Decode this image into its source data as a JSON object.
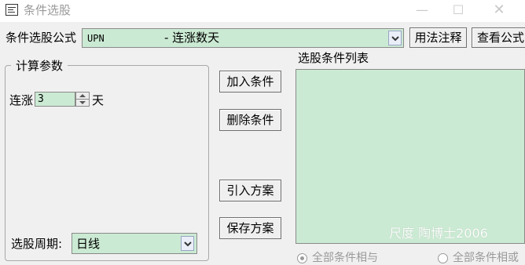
{
  "window": {
    "title": "条件选股",
    "controls": {
      "minimize": "—",
      "maximize": "☐",
      "close": "✕"
    }
  },
  "formula": {
    "label": "条件选股公式",
    "selected_code": "UPN",
    "selected_name": "- 连涨数天",
    "usage_note_button": "用法注释",
    "view_formula_button": "查看公式"
  },
  "params": {
    "group_title": "计算参数",
    "lianzhang_label": "连涨",
    "lianzhang_value": "3",
    "lianzhang_unit": "天",
    "period_label": "选股周期:",
    "period_value": "日线"
  },
  "actions": {
    "add_condition": "加入条件",
    "delete_condition": "删除条件",
    "import_plan": "引入方案",
    "save_plan": "保存方案"
  },
  "condition_list": {
    "label": "选股条件列表",
    "items": []
  },
  "logic": {
    "all_and": "全部条件相与",
    "all_or": "全部条件相或",
    "selected": "all_and"
  },
  "watermark": "尺度  陶博士2006",
  "colors": {
    "field_bg": "#cbead3",
    "window_bg": "#f0f0f0"
  }
}
